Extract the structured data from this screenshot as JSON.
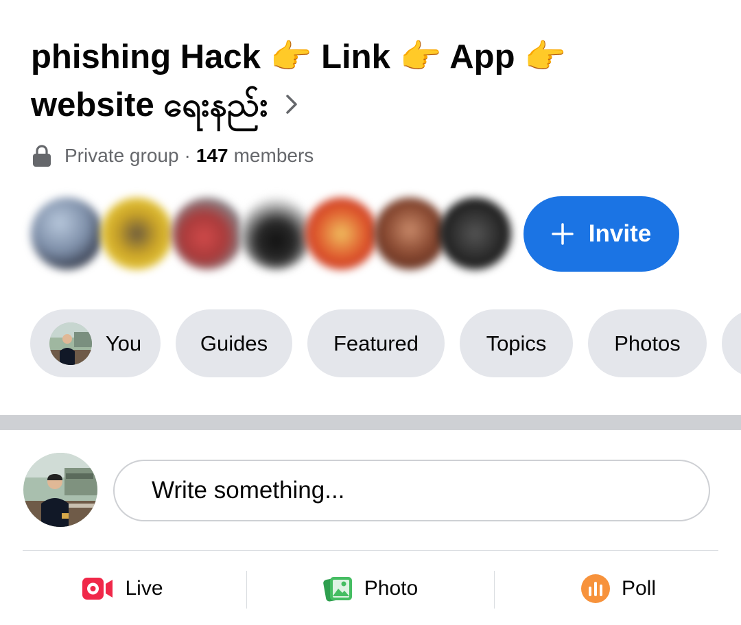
{
  "group": {
    "title": "phishing Hack 👉 Link 👉 App 👉\nwebsite ရေးနည်း",
    "privacy": "Private group",
    "separator": "·",
    "member_count": "147",
    "members_label": "members"
  },
  "invite": {
    "label": "Invite"
  },
  "chips": [
    "You",
    "Guides",
    "Featured",
    "Topics",
    "Photos"
  ],
  "composer": {
    "placeholder": "Write something..."
  },
  "actions": {
    "live": "Live",
    "photo": "Photo",
    "poll": "Poll"
  },
  "colors": {
    "accent": "#1b74e4",
    "live": "#f02849",
    "photo": "#45bd62",
    "poll": "#f7923b",
    "chip_bg": "#e4e6eb"
  }
}
